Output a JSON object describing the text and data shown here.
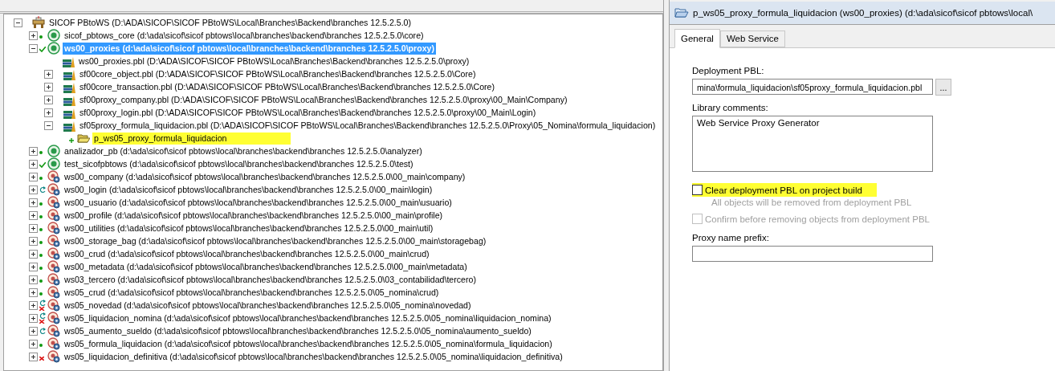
{
  "tree": {
    "label": "SICOF PBtoWS (D:\\ADA\\SICOF\\SICOF PBtoWS\\Local\\Branches\\Backend\\branches 12.5.2.5.0)",
    "kind": "workspace",
    "expanded": true,
    "selected": false,
    "children": [
      {
        "label": "sicof_pbtows_core (d:\\ada\\sicof\\sicof pbtows\\local\\branches\\backend\\branches 12.5.2.5.0\\core)",
        "kind": "app-target",
        "status": {
          "kind": "ok"
        },
        "expanded": false,
        "selected": false
      },
      {
        "label": "ws00_proxies (d:\\ada\\sicof\\sicof pbtows\\local\\branches\\backend\\branches 12.5.2.5.0\\proxy)",
        "kind": "app-target",
        "status": {
          "kind": "check"
        },
        "expanded": true,
        "selected": true,
        "children": [
          {
            "label": "ws00_proxies.pbl (D:\\ADA\\SICOF\\SICOF PBtoWS\\Local\\Branches\\Backend\\branches 12.5.2.5.0\\proxy)",
            "kind": "library",
            "selected": false
          },
          {
            "label": "sf00core_object.pbl (D:\\ADA\\SICOF\\SICOF PBtoWS\\Local\\Branches\\Backend\\branches 12.5.2.5.0\\Core)",
            "kind": "library",
            "expanded": false,
            "selected": false
          },
          {
            "label": "sf00core_transaction.pbl (D:\\ADA\\SICOF\\SICOF PBtoWS\\Local\\Branches\\Backend\\branches 12.5.2.5.0\\Core)",
            "kind": "library",
            "expanded": false,
            "selected": false
          },
          {
            "label": "sf00proxy_company.pbl (D:\\ADA\\SICOF\\SICOF PBtoWS\\Local\\Branches\\Backend\\branches 12.5.2.5.0\\proxy\\00_Main\\Company)",
            "kind": "library",
            "expanded": false,
            "selected": false
          },
          {
            "label": "sf00proxy_login.pbl (D:\\ADA\\SICOF\\SICOF PBtoWS\\Local\\Branches\\Backend\\branches 12.5.2.5.0\\proxy\\00_Main\\Login)",
            "kind": "library",
            "expanded": false,
            "selected": false
          },
          {
            "label": "sf05proxy_formula_liquidacion.pbl (D:\\ADA\\SICOF\\SICOF PBtoWS\\Local\\Branches\\Backend\\branches 12.5.2.5.0\\Proxy\\05_Nomina\\formula_liquidacion)",
            "kind": "library",
            "expanded": true,
            "selected": false,
            "children": [
              {
                "label": "p_ws05_proxy_formula_liquidacion",
                "kind": "project",
                "status": {
                  "kind": "new"
                },
                "selected": false,
                "highlighted": true
              }
            ]
          }
        ]
      },
      {
        "label": "analizador_pb (d:\\ada\\sicof\\sicof pbtows\\local\\branches\\backend\\branches 12.5.2.5.0\\analyzer)",
        "kind": "app-target",
        "status": {
          "kind": "ok"
        },
        "expanded": false,
        "selected": false
      },
      {
        "label": "test_sicofpbtows (d:\\ada\\sicof\\sicof pbtows\\local\\branches\\backend\\branches 12.5.2.5.0\\test)",
        "kind": "app-target",
        "status": {
          "kind": "check"
        },
        "expanded": false,
        "selected": false
      },
      {
        "label": "ws00_company (d:\\ada\\sicof\\sicof pbtows\\local\\branches\\backend\\branches 12.5.2.5.0\\00_main\\company)",
        "kind": "ws-target",
        "status": {
          "kind": "ok"
        },
        "expanded": false,
        "selected": false
      },
      {
        "label": "ws00_login (d:\\ada\\sicof\\sicof pbtows\\local\\branches\\backend\\branches 12.5.2.5.0\\00_main\\login)",
        "kind": "ws-target",
        "status": {
          "kind": "sync"
        },
        "expanded": false,
        "selected": false
      },
      {
        "label": "ws00_usuario (d:\\ada\\sicof\\sicof pbtows\\local\\branches\\backend\\branches 12.5.2.5.0\\00_main\\usuario)",
        "kind": "ws-target",
        "status": {
          "kind": "ok"
        },
        "expanded": false,
        "selected": false
      },
      {
        "label": "ws00_profile (d:\\ada\\sicof\\sicof pbtows\\local\\branches\\backend\\branches 12.5.2.5.0\\00_main\\profile)",
        "kind": "ws-target",
        "status": {
          "kind": "ok"
        },
        "expanded": false,
        "selected": false
      },
      {
        "label": "ws00_utilities (d:\\ada\\sicof\\sicof pbtows\\local\\branches\\backend\\branches 12.5.2.5.0\\00_main\\util)",
        "kind": "ws-target",
        "status": {
          "kind": "ok"
        },
        "expanded": false,
        "selected": false
      },
      {
        "label": "ws00_storage_bag (d:\\ada\\sicof\\sicof pbtows\\local\\branches\\backend\\branches 12.5.2.5.0\\00_main\\storagebag)",
        "kind": "ws-target",
        "status": {
          "kind": "ok"
        },
        "expanded": false,
        "selected": false
      },
      {
        "label": "ws00_crud (d:\\ada\\sicof\\sicof pbtows\\local\\branches\\backend\\branches 12.5.2.5.0\\00_main\\crud)",
        "kind": "ws-target",
        "status": {
          "kind": "ok"
        },
        "expanded": false,
        "selected": false
      },
      {
        "label": "ws00_metadata (d:\\ada\\sicof\\sicof pbtows\\local\\branches\\backend\\branches 12.5.2.5.0\\00_main\\metadata)",
        "kind": "ws-target",
        "status": {
          "kind": "ok"
        },
        "expanded": false,
        "selected": false
      },
      {
        "label": "ws03_tercero (d:\\ada\\sicof\\sicof pbtows\\local\\branches\\backend\\branches 12.5.2.5.0\\03_contabilidad\\tercero)",
        "kind": "ws-target",
        "status": {
          "kind": "ok"
        },
        "expanded": false,
        "selected": false
      },
      {
        "label": "ws05_crud (d:\\ada\\sicof\\sicof pbtows\\local\\branches\\backend\\branches 12.5.2.5.0\\05_nomina\\crud)",
        "kind": "ws-target",
        "status": {
          "kind": "ok"
        },
        "expanded": false,
        "selected": false
      },
      {
        "label": "ws05_novedad (d:\\ada\\sicof\\sicof pbtows\\local\\branches\\backend\\branches 12.5.2.5.0\\05_nomina\\novedad)",
        "kind": "ws-target",
        "status": {
          "kind": "sync-error"
        },
        "expanded": false,
        "selected": false
      },
      {
        "label": "ws05_liquidacion_nomina (d:\\ada\\sicof\\sicof pbtows\\local\\branches\\backend\\branches 12.5.2.5.0\\05_nomina\\liquidacion_nomina)",
        "kind": "ws-target",
        "status": {
          "kind": "sync-error"
        },
        "expanded": false,
        "selected": false
      },
      {
        "label": "ws05_aumento_sueldo (d:\\ada\\sicof\\sicof pbtows\\local\\branches\\backend\\branches 12.5.2.5.0\\05_nomina\\aumento_sueldo)",
        "kind": "ws-target",
        "status": {
          "kind": "sync"
        },
        "expanded": false,
        "selected": false
      },
      {
        "label": "ws05_formula_liquidacion (d:\\ada\\sicof\\sicof pbtows\\local\\branches\\backend\\branches 12.5.2.5.0\\05_nomina\\formula_liquidacion)",
        "kind": "ws-target",
        "status": {
          "kind": "ok"
        },
        "expanded": false,
        "selected": false
      },
      {
        "label": "ws05_liquidacion_definitiva (d:\\ada\\sicof\\sicof pbtows\\local\\branches\\backend\\branches 12.5.2.5.0\\05_nomina\\liquidacion_definitiva)",
        "kind": "ws-target",
        "status": {
          "kind": "error"
        },
        "expanded": false,
        "selected": false
      }
    ]
  },
  "properties": {
    "title": "p_ws05_proxy_formula_liquidacion (ws00_proxies) (d:\\ada\\sicof\\sicof pbtows\\local\\",
    "tabs": [
      {
        "label": "General",
        "selected": true
      },
      {
        "label": "Web Service",
        "selected": false
      }
    ],
    "deployment_pbl": {
      "label": "Deployment PBL:",
      "value": "mina\\formula_liquidacion\\sf05proxy_formula_liquidacion.pbl",
      "browse": "..."
    },
    "library_comments": {
      "label": "Library comments:",
      "value": "Web Service Proxy Generator"
    },
    "clear_pbl": {
      "label": "Clear deployment PBL on project build",
      "checked": false,
      "disabled": false,
      "highlighted": true,
      "note": "All objects will be removed from deployment PBL"
    },
    "confirm_remove": {
      "label": "Confirm before removing objects from deployment PBL",
      "checked": false,
      "disabled": true,
      "highlighted": false
    },
    "proxy_prefix": {
      "label": "Proxy name prefix:"
    }
  }
}
